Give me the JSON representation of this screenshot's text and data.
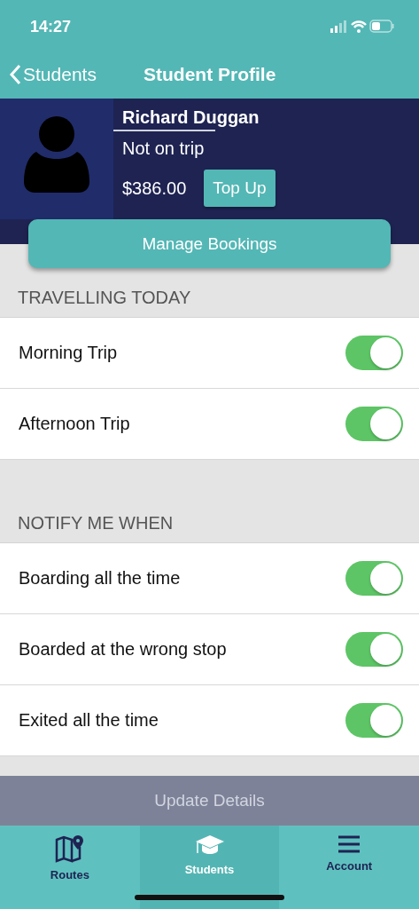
{
  "status_bar": {
    "time": "14:27"
  },
  "nav": {
    "back_label": "Students",
    "title": "Student Profile"
  },
  "profile": {
    "name": "Richard Duggan",
    "status": "Not on trip",
    "balance": "$386.00",
    "top_up_button": "Top Up"
  },
  "manage_button": "Manage Bookings",
  "sections": [
    {
      "header": "TRAVELLING TODAY",
      "items": [
        {
          "label": "Morning Trip",
          "on": true
        },
        {
          "label": "Afternoon Trip",
          "on": true
        }
      ]
    },
    {
      "header": "NOTIFY ME WHEN",
      "items": [
        {
          "label": "Boarding all the time",
          "on": true
        },
        {
          "label": "Boarded at the wrong stop",
          "on": true
        },
        {
          "label": "Exited all the time",
          "on": true
        }
      ]
    }
  ],
  "update_button": {
    "label": "Update Details",
    "disabled": true
  },
  "tabs": [
    {
      "label": "Routes",
      "selected": false
    },
    {
      "label": "Students",
      "selected": true
    },
    {
      "label": "Account",
      "selected": false
    }
  ]
}
